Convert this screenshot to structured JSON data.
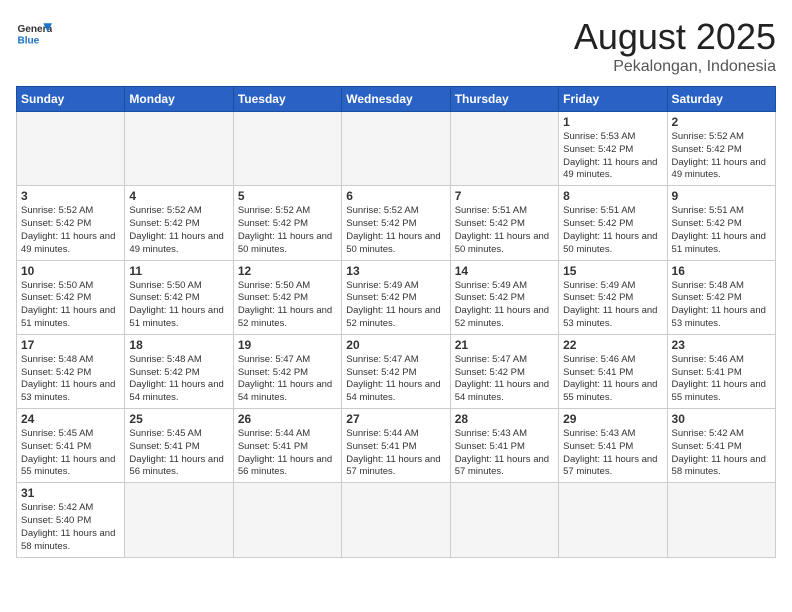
{
  "header": {
    "logo_general": "General",
    "logo_blue": "Blue",
    "month": "August 2025",
    "location": "Pekalongan, Indonesia"
  },
  "weekdays": [
    "Sunday",
    "Monday",
    "Tuesday",
    "Wednesday",
    "Thursday",
    "Friday",
    "Saturday"
  ],
  "weeks": [
    [
      {
        "day": "",
        "info": ""
      },
      {
        "day": "",
        "info": ""
      },
      {
        "day": "",
        "info": ""
      },
      {
        "day": "",
        "info": ""
      },
      {
        "day": "",
        "info": ""
      },
      {
        "day": "1",
        "info": "Sunrise: 5:53 AM\nSunset: 5:42 PM\nDaylight: 11 hours and 49 minutes."
      },
      {
        "day": "2",
        "info": "Sunrise: 5:52 AM\nSunset: 5:42 PM\nDaylight: 11 hours and 49 minutes."
      }
    ],
    [
      {
        "day": "3",
        "info": "Sunrise: 5:52 AM\nSunset: 5:42 PM\nDaylight: 11 hours and 49 minutes."
      },
      {
        "day": "4",
        "info": "Sunrise: 5:52 AM\nSunset: 5:42 PM\nDaylight: 11 hours and 49 minutes."
      },
      {
        "day": "5",
        "info": "Sunrise: 5:52 AM\nSunset: 5:42 PM\nDaylight: 11 hours and 50 minutes."
      },
      {
        "day": "6",
        "info": "Sunrise: 5:52 AM\nSunset: 5:42 PM\nDaylight: 11 hours and 50 minutes."
      },
      {
        "day": "7",
        "info": "Sunrise: 5:51 AM\nSunset: 5:42 PM\nDaylight: 11 hours and 50 minutes."
      },
      {
        "day": "8",
        "info": "Sunrise: 5:51 AM\nSunset: 5:42 PM\nDaylight: 11 hours and 50 minutes."
      },
      {
        "day": "9",
        "info": "Sunrise: 5:51 AM\nSunset: 5:42 PM\nDaylight: 11 hours and 51 minutes."
      }
    ],
    [
      {
        "day": "10",
        "info": "Sunrise: 5:50 AM\nSunset: 5:42 PM\nDaylight: 11 hours and 51 minutes."
      },
      {
        "day": "11",
        "info": "Sunrise: 5:50 AM\nSunset: 5:42 PM\nDaylight: 11 hours and 51 minutes."
      },
      {
        "day": "12",
        "info": "Sunrise: 5:50 AM\nSunset: 5:42 PM\nDaylight: 11 hours and 52 minutes."
      },
      {
        "day": "13",
        "info": "Sunrise: 5:49 AM\nSunset: 5:42 PM\nDaylight: 11 hours and 52 minutes."
      },
      {
        "day": "14",
        "info": "Sunrise: 5:49 AM\nSunset: 5:42 PM\nDaylight: 11 hours and 52 minutes."
      },
      {
        "day": "15",
        "info": "Sunrise: 5:49 AM\nSunset: 5:42 PM\nDaylight: 11 hours and 53 minutes."
      },
      {
        "day": "16",
        "info": "Sunrise: 5:48 AM\nSunset: 5:42 PM\nDaylight: 11 hours and 53 minutes."
      }
    ],
    [
      {
        "day": "17",
        "info": "Sunrise: 5:48 AM\nSunset: 5:42 PM\nDaylight: 11 hours and 53 minutes."
      },
      {
        "day": "18",
        "info": "Sunrise: 5:48 AM\nSunset: 5:42 PM\nDaylight: 11 hours and 54 minutes."
      },
      {
        "day": "19",
        "info": "Sunrise: 5:47 AM\nSunset: 5:42 PM\nDaylight: 11 hours and 54 minutes."
      },
      {
        "day": "20",
        "info": "Sunrise: 5:47 AM\nSunset: 5:42 PM\nDaylight: 11 hours and 54 minutes."
      },
      {
        "day": "21",
        "info": "Sunrise: 5:47 AM\nSunset: 5:42 PM\nDaylight: 11 hours and 54 minutes."
      },
      {
        "day": "22",
        "info": "Sunrise: 5:46 AM\nSunset: 5:41 PM\nDaylight: 11 hours and 55 minutes."
      },
      {
        "day": "23",
        "info": "Sunrise: 5:46 AM\nSunset: 5:41 PM\nDaylight: 11 hours and 55 minutes."
      }
    ],
    [
      {
        "day": "24",
        "info": "Sunrise: 5:45 AM\nSunset: 5:41 PM\nDaylight: 11 hours and 55 minutes."
      },
      {
        "day": "25",
        "info": "Sunrise: 5:45 AM\nSunset: 5:41 PM\nDaylight: 11 hours and 56 minutes."
      },
      {
        "day": "26",
        "info": "Sunrise: 5:44 AM\nSunset: 5:41 PM\nDaylight: 11 hours and 56 minutes."
      },
      {
        "day": "27",
        "info": "Sunrise: 5:44 AM\nSunset: 5:41 PM\nDaylight: 11 hours and 57 minutes."
      },
      {
        "day": "28",
        "info": "Sunrise: 5:43 AM\nSunset: 5:41 PM\nDaylight: 11 hours and 57 minutes."
      },
      {
        "day": "29",
        "info": "Sunrise: 5:43 AM\nSunset: 5:41 PM\nDaylight: 11 hours and 57 minutes."
      },
      {
        "day": "30",
        "info": "Sunrise: 5:42 AM\nSunset: 5:41 PM\nDaylight: 11 hours and 58 minutes."
      }
    ],
    [
      {
        "day": "31",
        "info": "Sunrise: 5:42 AM\nSunset: 5:40 PM\nDaylight: 11 hours and 58 minutes."
      },
      {
        "day": "",
        "info": ""
      },
      {
        "day": "",
        "info": ""
      },
      {
        "day": "",
        "info": ""
      },
      {
        "day": "",
        "info": ""
      },
      {
        "day": "",
        "info": ""
      },
      {
        "day": "",
        "info": ""
      }
    ]
  ]
}
